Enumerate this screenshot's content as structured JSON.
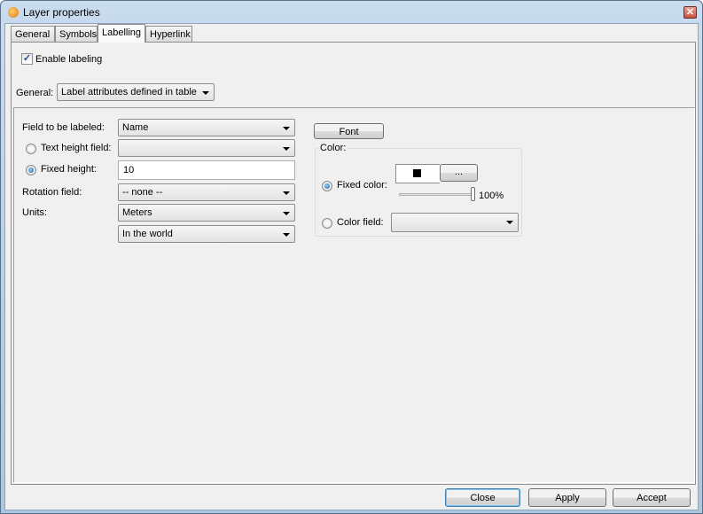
{
  "window": {
    "title": "Layer properties",
    "close_icon": "close-icon"
  },
  "tabs": [
    {
      "label": "General"
    },
    {
      "label": "Symbols"
    },
    {
      "label": "Labelling",
      "active": true
    },
    {
      "label": "Hyperlink"
    }
  ],
  "labelling": {
    "enable_label": "Enable labeling",
    "enable_checked": true,
    "general_label": "General:",
    "general_value": "Label attributes defined in table",
    "field_label": "Field to be labeled:",
    "field_value": "Name",
    "text_height_label": "Text height field:",
    "text_height_value": "",
    "fixed_height_label": "Fixed height:",
    "fixed_height_value": "10",
    "fixed_height_selected": true,
    "rotation_label": "Rotation field:",
    "rotation_value": "-- none --",
    "units_label": "Units:",
    "units_value": "Meters",
    "units_ref_value": "In the world",
    "font_button": "Font",
    "color_group": "Color:",
    "fixed_color_label": "Fixed color:",
    "fixed_color_selected": true,
    "fixed_color_value": "#000000",
    "color_picker_button": "...",
    "opacity_percent": "100%",
    "opacity_value": 100,
    "color_field_label": "Color field:",
    "color_field_value": ""
  },
  "footer": {
    "close": "Close",
    "apply": "Apply",
    "accept": "Accept"
  }
}
